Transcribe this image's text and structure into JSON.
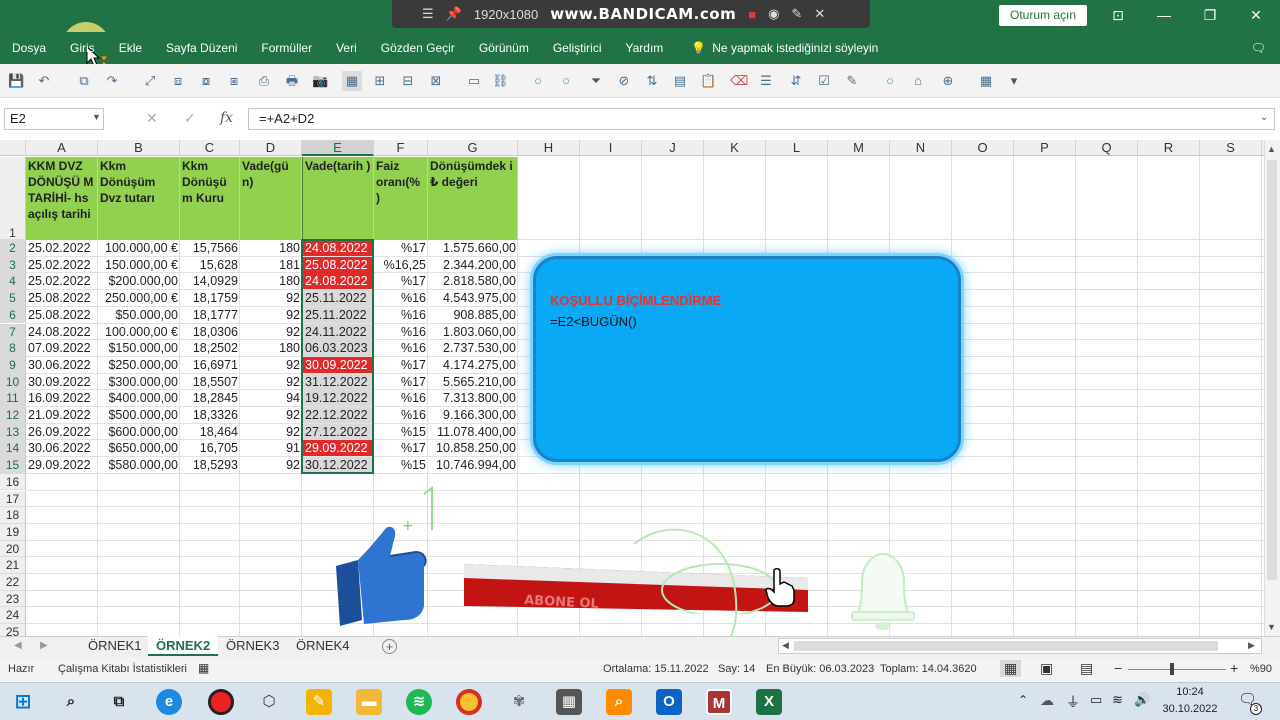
{
  "recorder": {
    "resolution": "1920x1080",
    "brand": "www.BANDICAM.com"
  },
  "titlebar": {
    "signin": "Oturum açın"
  },
  "menu": [
    "Dosya",
    "Giriş",
    "Ekle",
    "Sayfa Düzeni",
    "Formüller",
    "Veri",
    "Gözden Geçir",
    "Görünüm",
    "Geliştirici",
    "Yardım"
  ],
  "tell_me": "Ne yapmak istediğinizi söyleyin",
  "formula_bar": {
    "cell_ref": "E2",
    "formula": "=+A2+D2"
  },
  "columns": [
    "A",
    "B",
    "C",
    "D",
    "E",
    "F",
    "G",
    "H",
    "I",
    "J",
    "K",
    "L",
    "M",
    "N",
    "O",
    "P",
    "Q",
    "R",
    "S"
  ],
  "selected_column": "E",
  "row_numbers": [
    "1",
    "2",
    "3",
    "4",
    "5",
    "6",
    "7",
    "8",
    "9",
    "10",
    "11",
    "12",
    "13",
    "14",
    "15",
    "16",
    "17",
    "18",
    "19",
    "20",
    "21",
    "22",
    "23",
    "24",
    "25"
  ],
  "table_headers": [
    "KKM DVZ DÖNÜŞÜ M TARİHİ- hs açılış tarihi",
    "Kkm Dönüşüm Dvz tutarı",
    "Kkm Dönüşü m Kuru",
    "Vade(gü n)",
    "Vade(tarih )",
    "Faiz oranı(% )",
    "Dönüşümdek i ₺ değeri"
  ],
  "rows": [
    [
      "25.02.2022",
      "100.000,00 €",
      "15,7566",
      "180",
      "24.08.2022",
      "%17",
      "1.575.660,00",
      true
    ],
    [
      "25.02.2022",
      "150.000,00 €",
      "15,628",
      "181",
      "25.08.2022",
      "%16,25",
      "2.344.200,00",
      true
    ],
    [
      "25.02.2022",
      "$200.000,00",
      "14,0929",
      "180",
      "24.08.2022",
      "%17",
      "2.818.580,00",
      true
    ],
    [
      "25.08.2022",
      "250.000,00 €",
      "18,1759",
      "92",
      "25.11.2022",
      "%16",
      "4.543.975,00",
      false
    ],
    [
      "25.08.2022",
      "$50.000,00",
      "18,1777",
      "92",
      "25.11.2022",
      "%16",
      "908.885,00",
      false
    ],
    [
      "24.08.2022",
      "100.000,00 €",
      "18,0306",
      "92",
      "24.11.2022",
      "%16",
      "1.803.060,00",
      false
    ],
    [
      "07.09.2022",
      "$150.000,00",
      "18,2502",
      "180",
      "06.03.2023",
      "%16",
      "2.737.530,00",
      false
    ],
    [
      "30.06.2022",
      "$250.000,00",
      "16,6971",
      "92",
      "30.09.2022",
      "%17",
      "4.174.275,00",
      true
    ],
    [
      "30.09.2022",
      "$300.000,00",
      "18,5507",
      "92",
      "31.12.2022",
      "%17",
      "5.565.210,00",
      false
    ],
    [
      "16.09.2022",
      "$400.000,00",
      "18,2845",
      "94",
      "19.12.2022",
      "%16",
      "7.313.800,00",
      false
    ],
    [
      "21.09.2022",
      "$500.000,00",
      "18,3326",
      "92",
      "22.12.2022",
      "%16",
      "9.166.300,00",
      false
    ],
    [
      "26.09.2022",
      "$600.000,00",
      "18,464",
      "92",
      "27.12.2022",
      "%15",
      "11.078.400,00",
      false
    ],
    [
      "30.06.2022",
      "$650.000,00",
      "16,705",
      "91",
      "29.09.2022",
      "%17",
      "10.858.250,00",
      true
    ],
    [
      "29.09.2022",
      "$580.000,00",
      "18,5293",
      "92",
      "30.12.2022",
      "%15",
      "10.746.994,00",
      false
    ]
  ],
  "callout": {
    "title": "KOŞULLU BİÇİMLENDİRME",
    "formula": "=E2<BUGÜN()"
  },
  "subscribe_text": "ABONE OL",
  "sheet_tabs": [
    "ÖRNEK1",
    "ÖRNEK2",
    "ÖRNEK3",
    "ÖRNEK4"
  ],
  "active_sheet": "ÖRNEK2",
  "status": {
    "ready": "Hazır",
    "stats": "Çalışma Kitabı İstatistikleri",
    "average": "Ortalama: 15.11.2022",
    "count": "Say: 14",
    "max": "En Büyük: 06.03.2023",
    "sum": "Toplam: 14.04.3620",
    "zoom": "%90"
  },
  "clock": {
    "time": "10:24",
    "date": "30.10.2022"
  },
  "notification_count": "3",
  "colors": {
    "excel_green": "#217346",
    "header_fill": "#92d050",
    "conditional_red": "#e12b2b",
    "callout_blue": "#0aa9f5",
    "callout_title": "#e8322c"
  }
}
